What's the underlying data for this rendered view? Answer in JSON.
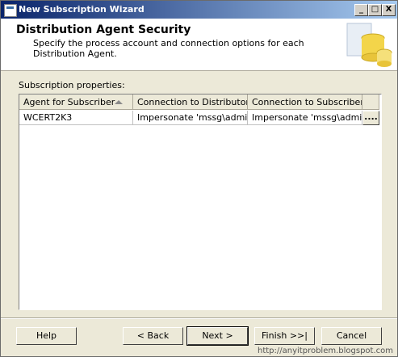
{
  "window": {
    "title": "New Subscription Wizard",
    "min_label": "_",
    "max_label": "□",
    "close_label": "X"
  },
  "header": {
    "title": "Distribution Agent Security",
    "subtitle": "Specify the process account and connection options for each Distribution Agent."
  },
  "panel": {
    "label": "Subscription properties:"
  },
  "grid": {
    "columns": [
      "Agent for Subscriber",
      "Connection to Distributor",
      "Connection to Subscriber"
    ],
    "rows": [
      {
        "agent": "WCERT2K3",
        "distributor": "Impersonate 'mssg\\admi...",
        "subscriber": "Impersonate 'mssg\\admi...",
        "button": "...."
      }
    ]
  },
  "buttons": {
    "help": "Help",
    "back": "< Back",
    "next": "Next >",
    "finish": "Finish >>|",
    "cancel": "Cancel"
  },
  "watermark": "http://anyitproblem.blogspot.com"
}
